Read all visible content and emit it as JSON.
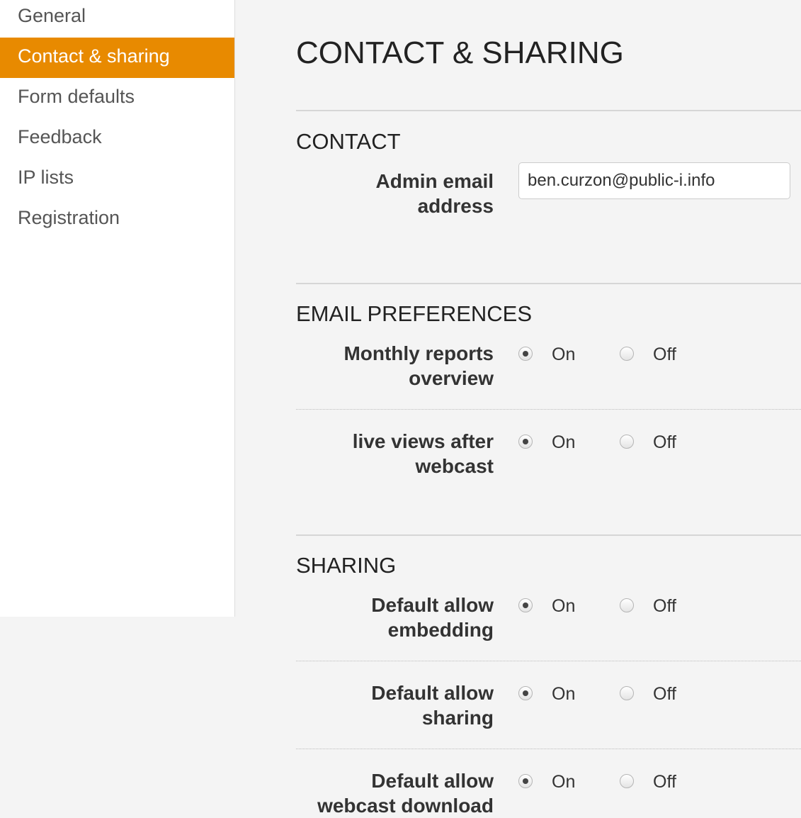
{
  "sidebar": {
    "items": [
      {
        "label": "General"
      },
      {
        "label": "Contact & sharing"
      },
      {
        "label": "Form defaults"
      },
      {
        "label": "Feedback"
      },
      {
        "label": "IP lists"
      },
      {
        "label": "Registration"
      }
    ],
    "active_index": 1
  },
  "colors": {
    "accent": "#e88a00"
  },
  "page": {
    "title": "CONTACT & SHARING"
  },
  "contact": {
    "title": "CONTACT",
    "admin_email": {
      "label": "Admin email address",
      "value": "ben.curzon@public-i.info"
    }
  },
  "email_preferences": {
    "title": "EMAIL PREFERENCES",
    "fields": [
      {
        "label": "Monthly reports overview",
        "on_label": "On",
        "off_label": "Off",
        "selected": "On"
      },
      {
        "label": "live views after webcast",
        "on_label": "On",
        "off_label": "Off",
        "selected": "On"
      }
    ]
  },
  "sharing": {
    "title": "SHARING",
    "fields": [
      {
        "label": "Default allow embedding",
        "on_label": "On",
        "off_label": "Off",
        "selected": "On"
      },
      {
        "label": "Default allow sharing",
        "on_label": "On",
        "off_label": "Off",
        "selected": "On"
      },
      {
        "label": "Default allow webcast download",
        "on_label": "On",
        "off_label": "Off",
        "selected": "On"
      }
    ]
  }
}
